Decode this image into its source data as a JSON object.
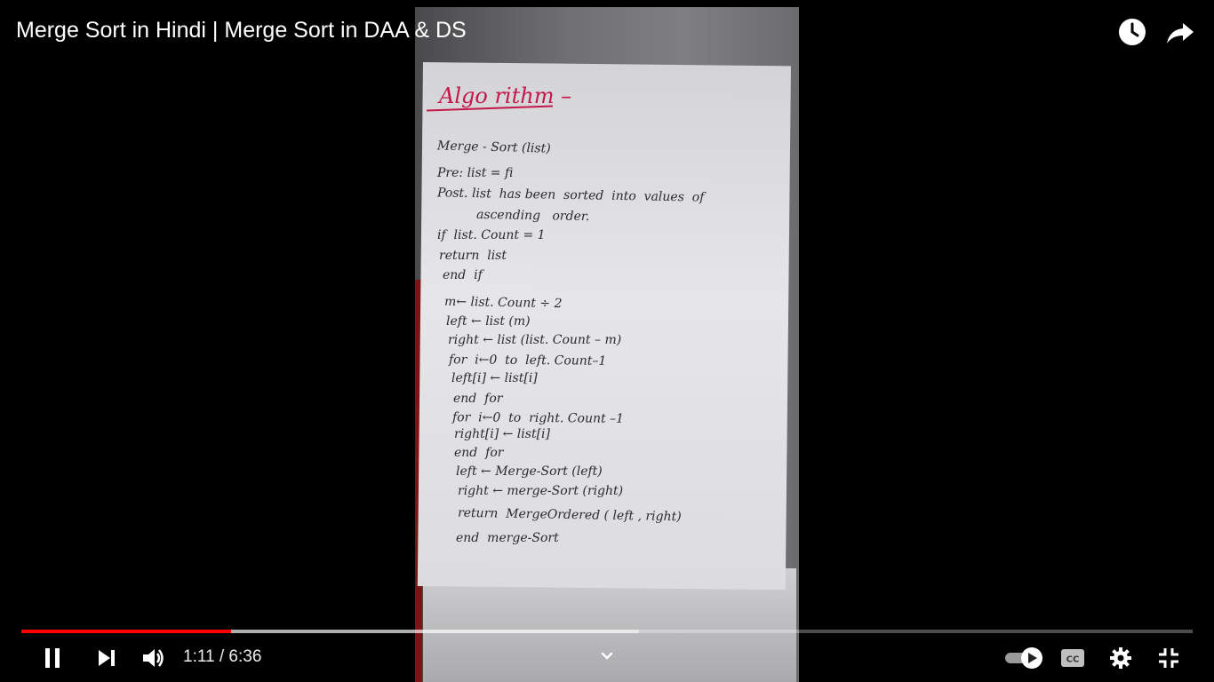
{
  "video": {
    "title": "Merge Sort in Hindi | Merge Sort in DAA & DS",
    "notes_heading": "Algo rithm –",
    "notes_lines": [
      "Merge - Sort (list)",
      "Pre: list = fi",
      "Post. list  has been  sorted  into  values  of",
      "ascending   order.",
      "if  list. Count = 1",
      "return  list",
      "end  if",
      "m← list. Count ÷ 2",
      "left ← list (m)",
      "right ← list (list. Count – m)",
      "for  i←0  to  left. Count–1",
      "left[i] ← list[i]",
      "end  for",
      "for  i←0  to  right. Count –1",
      "right[i] ← list[i]",
      "end  for",
      "left ← Merge-Sort (left)",
      "right ← merge-Sort (right)",
      "return  MergeOrdered ( left , right)",
      "end  merge-Sort"
    ]
  },
  "player": {
    "current_time": "1:11",
    "separator": "/",
    "duration": "6:36",
    "time_display": "1:11 / 6:36",
    "played_fraction": 0.179,
    "buffered_fraction": 0.527,
    "autoplay": true,
    "icons": {
      "watch_later": "clock-icon",
      "share": "share-arrow-icon",
      "pause": "pause-icon",
      "next": "next-icon",
      "volume": "volume-icon",
      "chevron": "chevron-down-icon",
      "autoplay": "autoplay-toggle-icon",
      "captions": "cc-icon",
      "settings": "gear-icon",
      "exit_fullscreen": "exit-fullscreen-icon"
    },
    "colors": {
      "played": "#ff0000",
      "heading_ink": "#c2184a"
    }
  }
}
